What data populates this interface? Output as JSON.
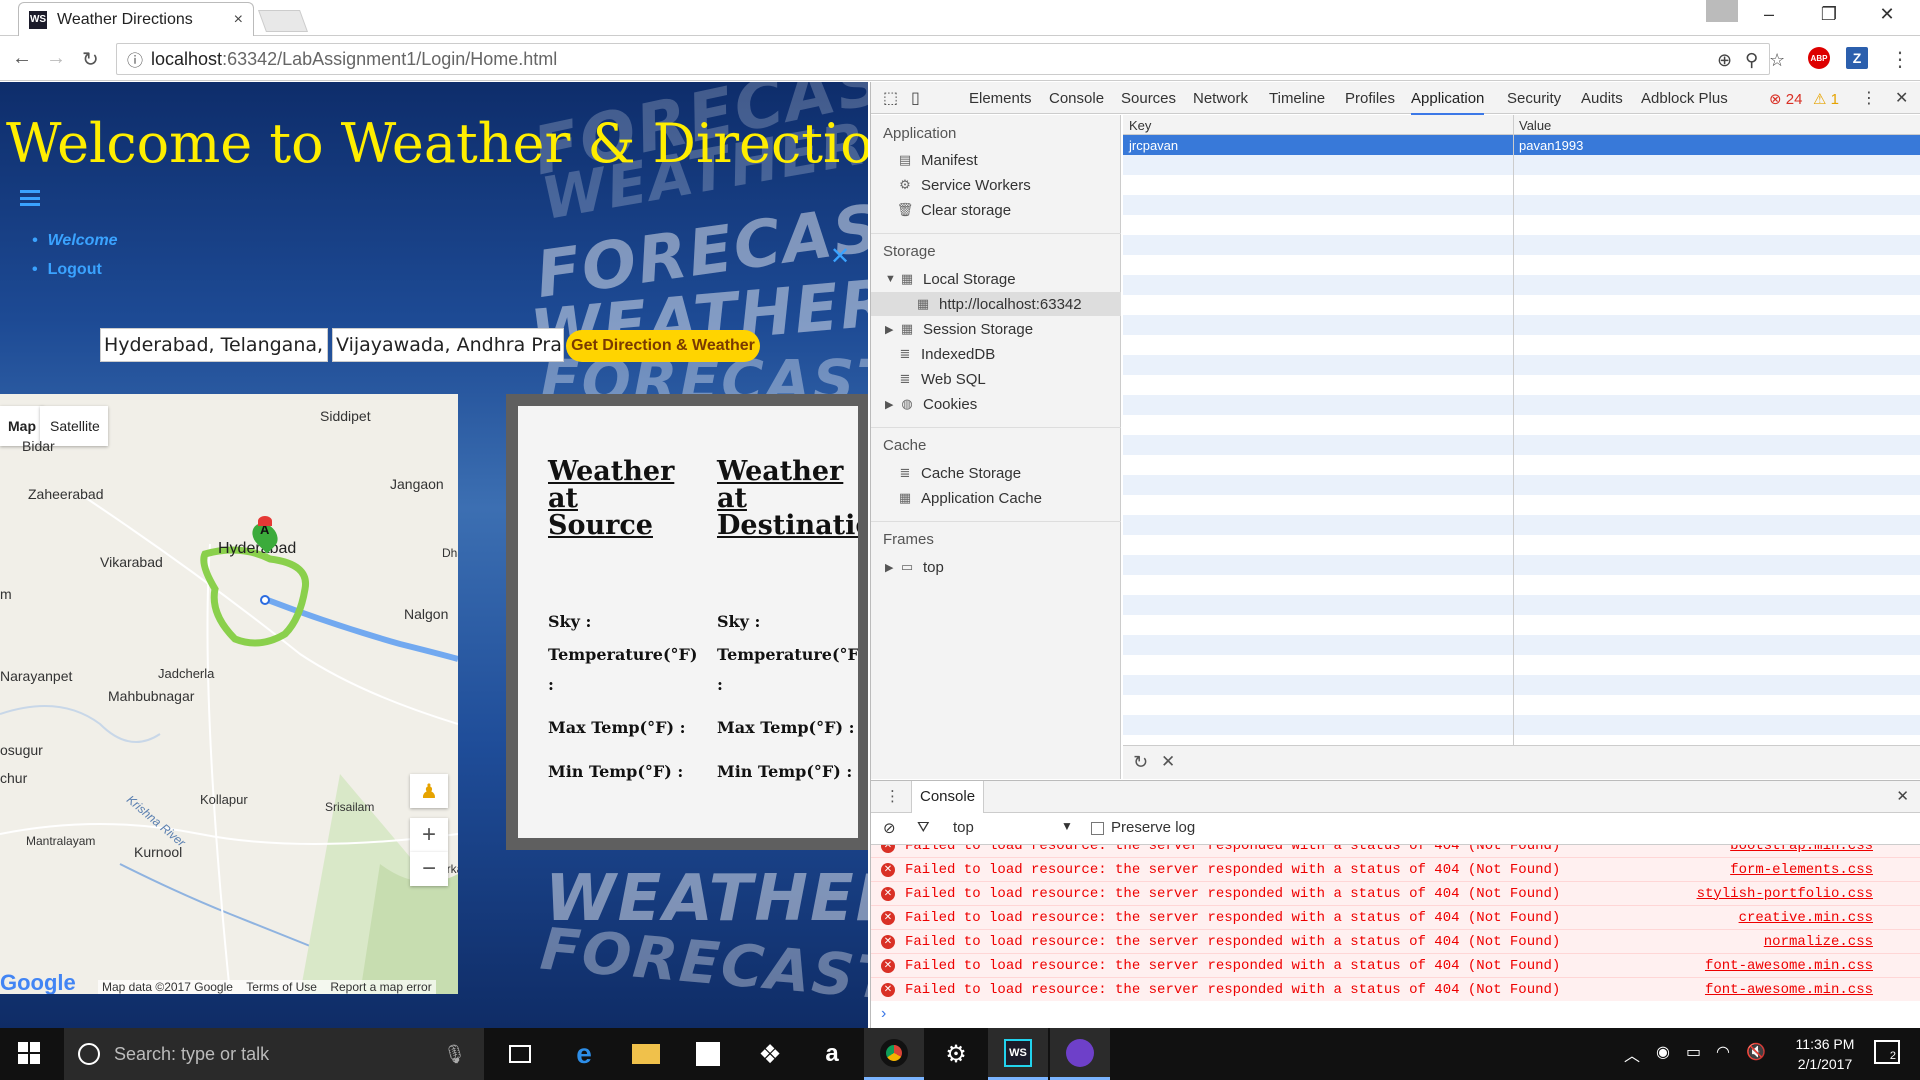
{
  "browser": {
    "tab_title": "Weather Directions",
    "tab_close": "×",
    "url_host": "localhost",
    "url_rest": ":63342/LabAssignment1/Login/Home.html",
    "extensions": {
      "abp": "ABP",
      "z": "Z"
    },
    "window_controls": {
      "minimize": "–",
      "maximize": "❐",
      "close": "✕"
    }
  },
  "page": {
    "heading": "Welcome to Weather & Directions...",
    "nav": {
      "welcome": "Welcome",
      "logout": "Logout",
      "close": "✕"
    },
    "source_value": "Hyderabad, Telangana, India",
    "destination_value": "Vijayawada, Andhra Pradesh, India",
    "submit_label": "Get Direction & Weather",
    "background_words": [
      "FORECAST",
      "WEATHER",
      "FORECAST",
      "WEATHER",
      "FORECAST",
      "WEATHER",
      "FORECAST"
    ]
  },
  "map": {
    "type_map": "Map",
    "type_satellite": "Satellite",
    "cities": {
      "siddipet": "Siddipet",
      "bidar": "Bidar",
      "jangaon": "Jangaon",
      "zaheerabad": "Zaheerabad",
      "hyderabad": "Hyderabad",
      "vikarabad": "Vikarabad",
      "nalgonda": "Nalgon",
      "narayanpet": "Narayanpet",
      "jadcherla": "Jadcherla",
      "mahbubnagar": "Mahbubnagar",
      "kollapur": "Kollapur",
      "srisailam": "Srisailam",
      "mantralayam": "Mantralayam",
      "kurnool": "Kurnool",
      "sugur": "osugur",
      "chur": "chur",
      "krishna": "Krishna River",
      "dha": "Dha",
      "markapur": "Markap",
      "m": "m"
    },
    "marker_label": "A",
    "zoom_in": "+",
    "zoom_out": "−",
    "logo": "Google",
    "footer": {
      "data": "Map data ©2017 Google",
      "terms": "Terms of Use",
      "report": "Report a map error"
    }
  },
  "weather": {
    "source_title": "Weather at Source",
    "dest_title": "Weather at Destination",
    "fields": {
      "sky": "Sky :",
      "temperature": "Temperature(°F)",
      "temp_colon": ":",
      "max_temp": "Max Temp(°F) :",
      "min_temp": "Min Temp(°F) :"
    }
  },
  "devtools": {
    "tabs": [
      "Elements",
      "Console",
      "Sources",
      "Network",
      "Timeline",
      "Profiles",
      "Application",
      "Security",
      "Audits",
      "Adblock Plus"
    ],
    "active_tab": "Application",
    "error_count": "24",
    "warning_count": "1",
    "sidebar": {
      "application_head": "Application",
      "manifest": "Manifest",
      "service_workers": "Service Workers",
      "clear_storage": "Clear storage",
      "storage_head": "Storage",
      "local_storage": "Local Storage",
      "local_origin": "http://localhost:63342",
      "session_storage": "Session Storage",
      "indexeddb": "IndexedDB",
      "websql": "Web SQL",
      "cookies": "Cookies",
      "cache_head": "Cache",
      "cache_storage": "Cache Storage",
      "application_cache": "Application Cache",
      "frames_head": "Frames",
      "frames_top": "top"
    },
    "table": {
      "key_header": "Key",
      "value_header": "Value",
      "rows": [
        {
          "key": "jrcpavan",
          "value": "pavan1993"
        }
      ]
    },
    "console": {
      "tab_label": "Console",
      "context": "top",
      "preserve_log": "Preserve log",
      "messages": [
        {
          "text": "Failed to load resource: the server responded with a status of 404 (Not Found)",
          "source": "bootstrap.min.css"
        },
        {
          "text": "Failed to load resource: the server responded with a status of 404 (Not Found)",
          "source": "form-elements.css"
        },
        {
          "text": "Failed to load resource: the server responded with a status of 404 (Not Found)",
          "source": "stylish-portfolio.css"
        },
        {
          "text": "Failed to load resource: the server responded with a status of 404 (Not Found)",
          "source": "creative.min.css"
        },
        {
          "text": "Failed to load resource: the server responded with a status of 404 (Not Found)",
          "source": "normalize.css"
        },
        {
          "text": "Failed to load resource: the server responded with a status of 404 (Not Found)",
          "source": "font-awesome.min.css"
        },
        {
          "text": "Failed to load resource: the server responded with a status of 404 (Not Found)",
          "source": "font-awesome.min.css"
        }
      ],
      "prompt": "›"
    }
  },
  "taskbar": {
    "search_placeholder": "Search: type or talk",
    "time": "11:36 PM",
    "date": "2/1/2017",
    "notifications": "2",
    "ws_label": "WS"
  }
}
